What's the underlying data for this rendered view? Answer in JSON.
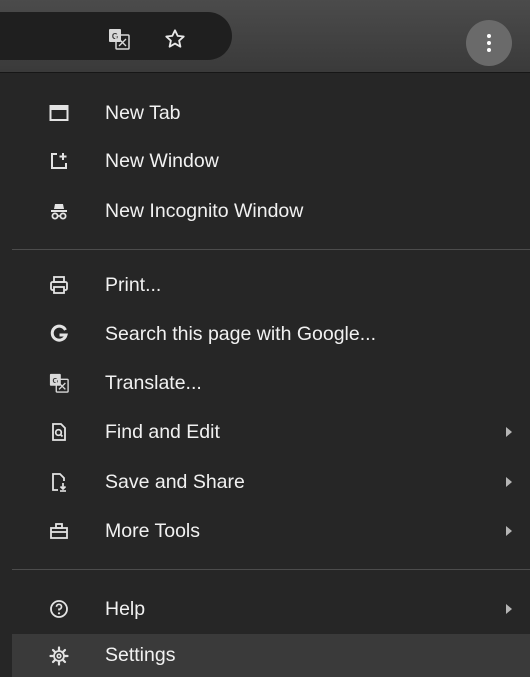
{
  "toolbar": {
    "icons": [
      "translate-icon",
      "bookmark-star-icon",
      "more-vertical-icon"
    ]
  },
  "menu": {
    "groups": [
      {
        "items": [
          {
            "label": "New Tab",
            "icon": "new-tab-icon"
          },
          {
            "label": "New Window",
            "icon": "new-window-icon"
          },
          {
            "label": "New Incognito Window",
            "icon": "incognito-icon"
          }
        ]
      },
      {
        "items": [
          {
            "label": "Print...",
            "icon": "print-icon"
          },
          {
            "label": "Search this page with Google...",
            "icon": "google-g-icon"
          },
          {
            "label": "Translate...",
            "icon": "translate-icon"
          },
          {
            "label": "Find and Edit",
            "icon": "find-icon",
            "submenu": true
          },
          {
            "label": "Save and Share",
            "icon": "save-share-icon",
            "submenu": true
          },
          {
            "label": "More Tools",
            "icon": "toolbox-icon",
            "submenu": true
          }
        ]
      },
      {
        "items": [
          {
            "label": "Help",
            "icon": "help-icon",
            "submenu": true
          },
          {
            "label": "Settings",
            "icon": "gear-icon",
            "highlighted": true
          }
        ]
      }
    ]
  },
  "colors": {
    "menu_background": "#262626",
    "highlight": "#3a3a3a",
    "text": "#f1f1f1",
    "separator": "#4c4c4c"
  }
}
